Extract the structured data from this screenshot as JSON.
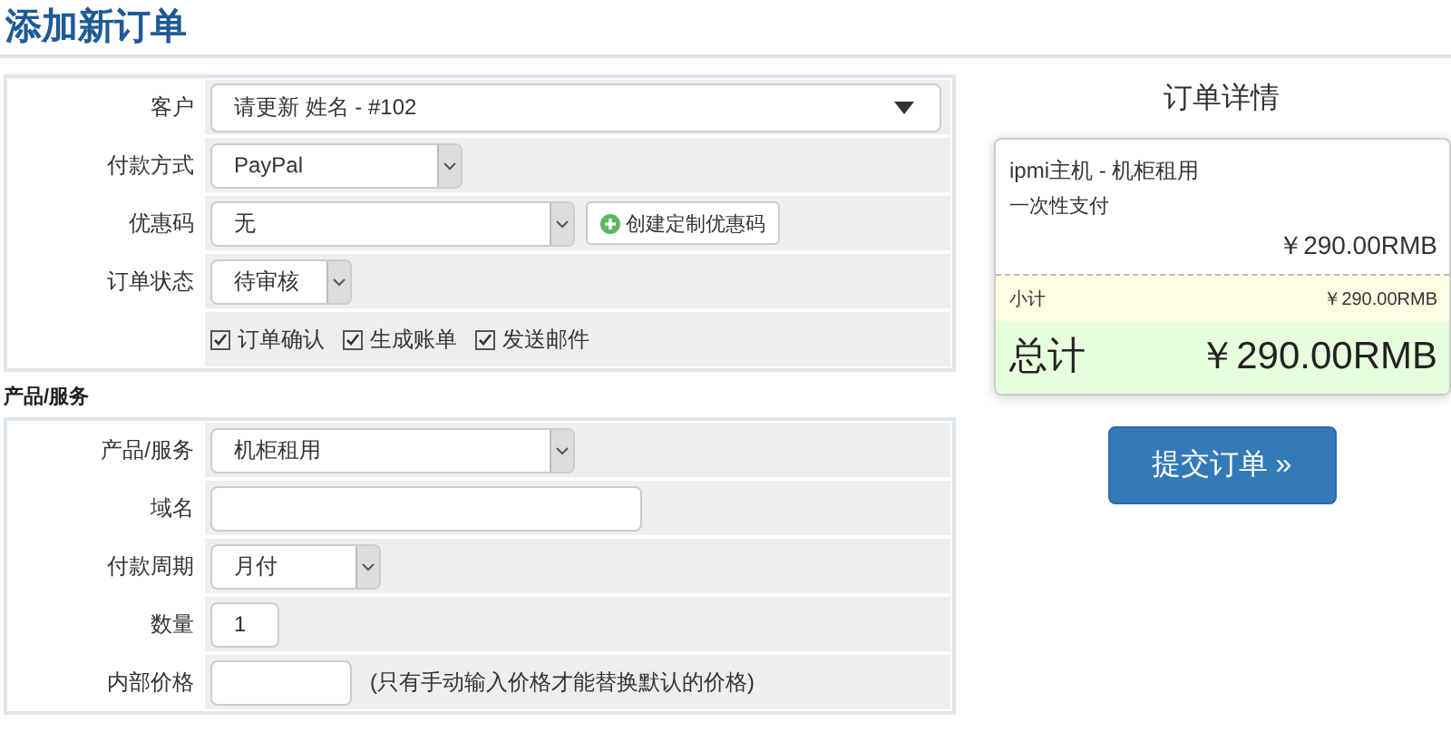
{
  "page_title": "添加新订单",
  "order_form": {
    "fields": [
      {
        "label": "客户",
        "kind": "combo",
        "value": "请更新 姓名 - #102"
      },
      {
        "label": "付款方式",
        "kind": "select",
        "value": "PayPal"
      },
      {
        "label": "优惠码",
        "kind": "select",
        "value": "无",
        "button": {
          "label": "创建定制优惠码"
        }
      },
      {
        "label": "订单状态",
        "kind": "select",
        "value": "待审核"
      }
    ],
    "checkboxes": [
      {
        "label": "订单确认",
        "checked": true
      },
      {
        "label": "生成账单",
        "checked": true
      },
      {
        "label": "发送邮件",
        "checked": true
      }
    ]
  },
  "products": {
    "title": "产品/服务",
    "fields": [
      {
        "label": "产品/服务",
        "kind": "select",
        "value": "机柜租用"
      },
      {
        "label": "域名",
        "kind": "input"
      },
      {
        "label": "付款周期",
        "kind": "select",
        "value": "月付"
      },
      {
        "label": "数量",
        "kind": "input",
        "value": "1"
      },
      {
        "label": "内部价格",
        "kind": "input",
        "note": "(只有手动输入价格才能替换默认的价格)"
      }
    ]
  },
  "summary": {
    "title": "订单详情",
    "item": {
      "name": "ipmi主机 - 机柜租用",
      "billing": "一次性支付",
      "price": "￥290.00RMB"
    },
    "subtotal": {
      "label": "小计",
      "value": "￥290.00RMB"
    },
    "total": {
      "label": "总计",
      "value": "￥290.00RMB"
    },
    "submit": "提交订单 »"
  }
}
